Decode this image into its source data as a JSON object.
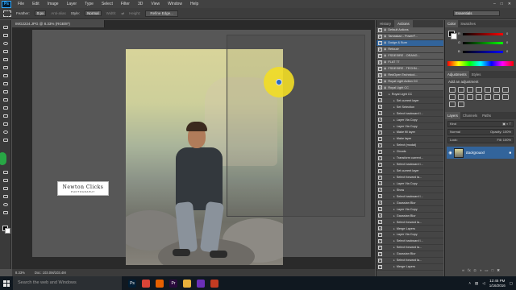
{
  "menubar": {
    "logo": "Ps",
    "items": [
      "File",
      "Edit",
      "Image",
      "Layer",
      "Type",
      "Select",
      "Filter",
      "3D",
      "View",
      "Window",
      "Help"
    ]
  },
  "options": {
    "feather_label": "Feather:",
    "feather_value": "0 px",
    "antialias": "Anti-alias",
    "style_label": "Style:",
    "style_value": "Normal",
    "width_label": "Width:",
    "height_label": "Height:",
    "refine_edge": "Refine Edge...",
    "workspace": "Essentials"
  },
  "document": {
    "tab_title": "IMG2224.JPG @ 8.33% (RGB/8*)",
    "zoom": "8.33%",
    "doc_size": "Doc: 103.0M/103.4M"
  },
  "watermark": {
    "title": "Newton Clicks",
    "subtitle": "PHOTOGRAPHY"
  },
  "actions_panel": {
    "tabs": [
      "History",
      "Actions"
    ],
    "active_tab": "Actions",
    "rows": [
      {
        "label": "Default Actions",
        "kind": "set",
        "checked": true
      },
      {
        "label": "Tamaskan - PowerF...",
        "kind": "set",
        "checked": true
      },
      {
        "label": "Dodge & Burn",
        "kind": "set",
        "checked": true,
        "selected": true
      },
      {
        "label": "Retouch",
        "kind": "set",
        "checked": true
      },
      {
        "label": "FSDESIRE - ORANG...",
        "kind": "set",
        "checked": true
      },
      {
        "label": "FLAT 77",
        "kind": "set",
        "checked": true
      },
      {
        "label": "FSDESIRE - TECHN...",
        "kind": "set",
        "checked": true
      },
      {
        "label": "RedOpen Technicol...",
        "kind": "set",
        "checked": true
      },
      {
        "label": "Royal Light Action CC",
        "kind": "set",
        "checked": true
      },
      {
        "label": "Royal Light CC",
        "kind": "set",
        "checked": true
      },
      {
        "label": "Royal Light CC",
        "kind": "action",
        "checked": true
      },
      {
        "label": "Set current layer",
        "kind": "step",
        "checked": true
      },
      {
        "label": "Set Selection",
        "kind": "step",
        "checked": true
      },
      {
        "label": "Select backward l...",
        "kind": "step",
        "checked": true
      },
      {
        "label": "Layer Via Copy",
        "kind": "step",
        "checked": true
      },
      {
        "label": "Layer Via Copy",
        "kind": "step",
        "checked": true
      },
      {
        "label": "Make fill layer",
        "kind": "step",
        "checked": true
      },
      {
        "label": "Make layer",
        "kind": "step",
        "checked": true
      },
      {
        "label": "Select (modal)",
        "kind": "step",
        "checked": true
      },
      {
        "label": "Clouds",
        "kind": "step",
        "checked": true
      },
      {
        "label": "Transform current...",
        "kind": "step",
        "checked": true
      },
      {
        "label": "Select backward l...",
        "kind": "step",
        "checked": true
      },
      {
        "label": "Set current layer",
        "kind": "step",
        "checked": true
      },
      {
        "label": "Select forward la...",
        "kind": "step",
        "checked": true
      },
      {
        "label": "Layer Via Copy",
        "kind": "step",
        "checked": true
      },
      {
        "label": "Show",
        "kind": "step",
        "checked": true
      },
      {
        "label": "Select backward l...",
        "kind": "step",
        "checked": true
      },
      {
        "label": "Gaussian Blur",
        "kind": "step",
        "checked": true
      },
      {
        "label": "Layer Via Copy",
        "kind": "step",
        "checked": true
      },
      {
        "label": "Gaussian Blur",
        "kind": "step",
        "checked": true
      },
      {
        "label": "Select forward la...",
        "kind": "step",
        "checked": true
      },
      {
        "label": "Merge Layers",
        "kind": "step",
        "checked": true
      },
      {
        "label": "Layer Via Copy",
        "kind": "step",
        "checked": true
      },
      {
        "label": "Select backward l...",
        "kind": "step",
        "checked": true
      },
      {
        "label": "Select forward la...",
        "kind": "step",
        "checked": true
      },
      {
        "label": "Gaussian Blur",
        "kind": "step",
        "checked": true
      },
      {
        "label": "Select forward la...",
        "kind": "step",
        "checked": true
      },
      {
        "label": "Merge Layers",
        "kind": "step",
        "checked": true
      }
    ]
  },
  "right_panel": {
    "color_tabs": [
      "Color",
      "Swatches"
    ],
    "slider_letters": [
      "R",
      "G",
      "B"
    ],
    "slider_values": [
      "0",
      "0",
      "0"
    ],
    "adjust_tabs": [
      "Adjustments",
      "Styles"
    ],
    "adjust_title": "Add an adjustment",
    "layer_tabs": [
      "Layers",
      "Channels",
      "Paths"
    ],
    "kind_label": "Kind",
    "blend_mode": "Normal",
    "opacity_label": "Opacity: 100%",
    "lock_label": "Lock:",
    "fill_label": "Fill: 100%",
    "layer_name": "Background"
  },
  "taskbar": {
    "search_placeholder": "Search the web and Windows",
    "time": "12:45 PM",
    "date": "1/16/2016",
    "apps": [
      {
        "icon": "ps-app-icon",
        "label": "Ps",
        "color": "#001d34"
      },
      {
        "icon": "chrome-icon",
        "label": "",
        "color": "#db4437"
      },
      {
        "icon": "firefox-icon",
        "label": "",
        "color": "#e66000"
      },
      {
        "icon": "premiere-icon",
        "label": "Pr",
        "color": "#2a0a3c"
      },
      {
        "icon": "explorer-icon",
        "label": "",
        "color": "#e8b13c"
      },
      {
        "icon": "media-icon",
        "label": "",
        "color": "#6a2fb8"
      },
      {
        "icon": "store-icon",
        "label": "",
        "color": "#c23b22"
      }
    ]
  },
  "colors": {
    "accent_blue": "#32649b",
    "highlight_yellow": "#f2dd25"
  }
}
